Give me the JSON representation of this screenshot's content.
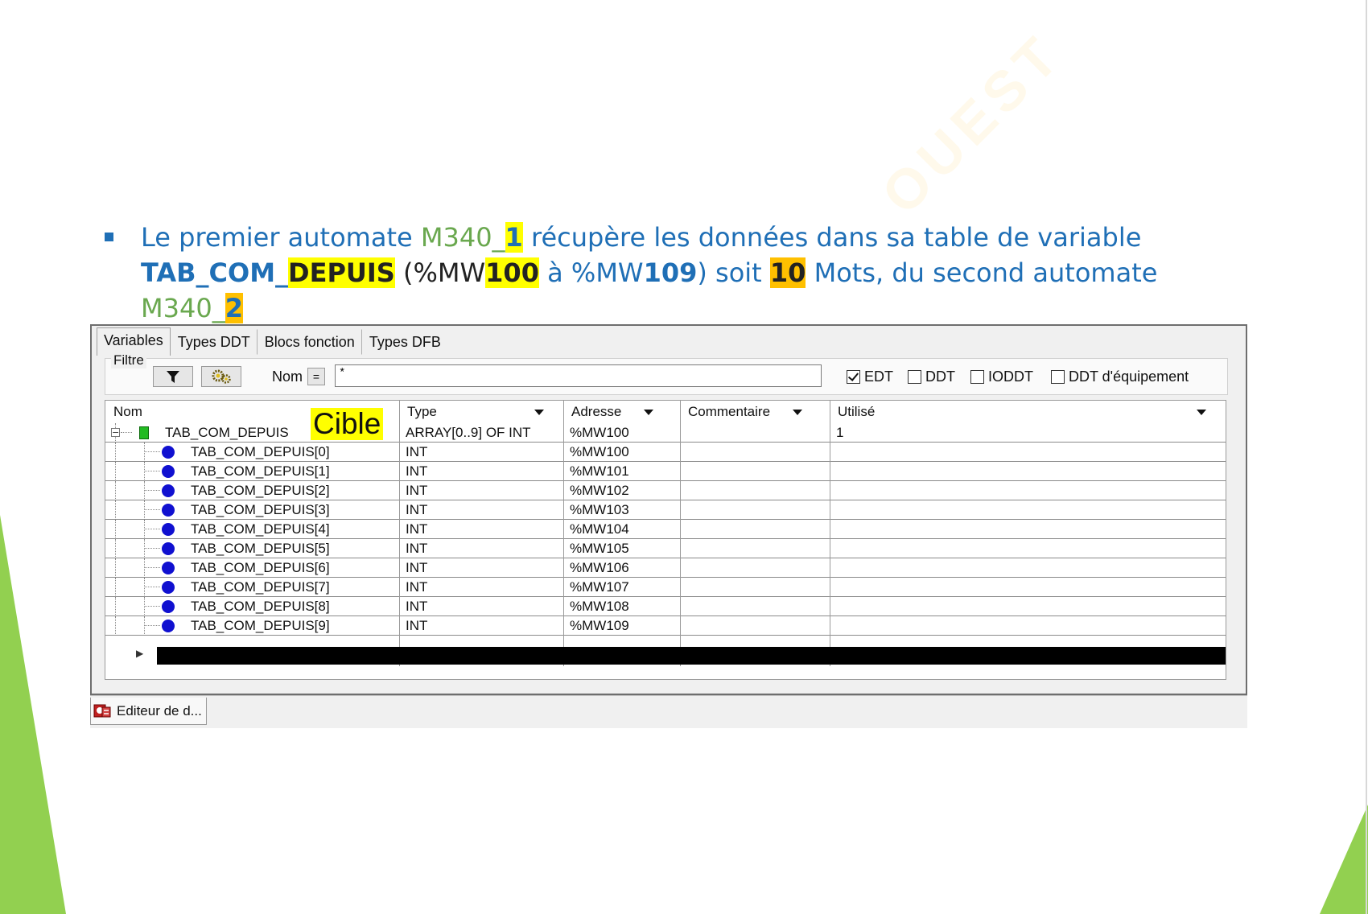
{
  "slide": {
    "sentence_parts": {
      "p1": "Le premier automate ",
      "p2": "M340_",
      "p3": "1",
      "p4": " récupère les données dans sa table de variable",
      "p5": "TAB_COM_",
      "p6": "DEPUIS",
      "p7": " (%MW",
      "p8": "100",
      "p9": " à %MW",
      "p10": "109",
      "p11": ") soit ",
      "p12": "10",
      "p13": " Mots, du second automate ",
      "p14": "M340_",
      "p15": "2"
    },
    "watermark": "OUEST",
    "callout": "Cible"
  },
  "colors": {
    "accent_blue": "#1f6fb6",
    "accent_green": "#6aa84f",
    "highlight_yellow": "#ffff00",
    "highlight_orange": "#ffc000"
  },
  "editor": {
    "tabs": [
      "Variables",
      "Types DDT",
      "Blocs fonction",
      "Types DFB"
    ],
    "filter": {
      "group_label": "Filtre",
      "filter_icon": "funnel-icon",
      "settings_icon": "gears-icon",
      "name_label": "Nom",
      "equals_button": "=",
      "name_value": "*",
      "checkboxes": [
        {
          "label": "EDT",
          "checked": true
        },
        {
          "label": "DDT",
          "checked": false
        },
        {
          "label": "IODDT",
          "checked": false
        },
        {
          "label": "DDT d'équipement",
          "checked": false
        }
      ]
    },
    "columns": [
      "Nom",
      "Type",
      "Adresse",
      "Commentaire",
      "Utilisé"
    ],
    "rows": [
      {
        "name": "TAB_COM_DEPUIS",
        "type": "ARRAY[0..9] OF INT",
        "address": "%MW100",
        "comment": "",
        "used": "1",
        "kind": "parent"
      },
      {
        "name": "TAB_COM_DEPUIS[0]",
        "type": "INT",
        "address": "%MW100",
        "comment": "",
        "used": ""
      },
      {
        "name": "TAB_COM_DEPUIS[1]",
        "type": "INT",
        "address": "%MW101",
        "comment": "",
        "used": ""
      },
      {
        "name": "TAB_COM_DEPUIS[2]",
        "type": "INT",
        "address": "%MW102",
        "comment": "",
        "used": ""
      },
      {
        "name": "TAB_COM_DEPUIS[3]",
        "type": "INT",
        "address": "%MW103",
        "comment": "",
        "used": ""
      },
      {
        "name": "TAB_COM_DEPUIS[4]",
        "type": "INT",
        "address": "%MW104",
        "comment": "",
        "used": ""
      },
      {
        "name": "TAB_COM_DEPUIS[5]",
        "type": "INT",
        "address": "%MW105",
        "comment": "",
        "used": ""
      },
      {
        "name": "TAB_COM_DEPUIS[6]",
        "type": "INT",
        "address": "%MW106",
        "comment": "",
        "used": ""
      },
      {
        "name": "TAB_COM_DEPUIS[7]",
        "type": "INT",
        "address": "%MW107",
        "comment": "",
        "used": ""
      },
      {
        "name": "TAB_COM_DEPUIS[8]",
        "type": "INT",
        "address": "%MW108",
        "comment": "",
        "used": ""
      },
      {
        "name": "TAB_COM_DEPUIS[9]",
        "type": "INT",
        "address": "%MW109",
        "comment": "",
        "used": ""
      }
    ],
    "new_row_marker": "▶"
  },
  "statusbar": {
    "tab_label": "Editeur de d...",
    "tab_icon": "data-editor-icon"
  }
}
